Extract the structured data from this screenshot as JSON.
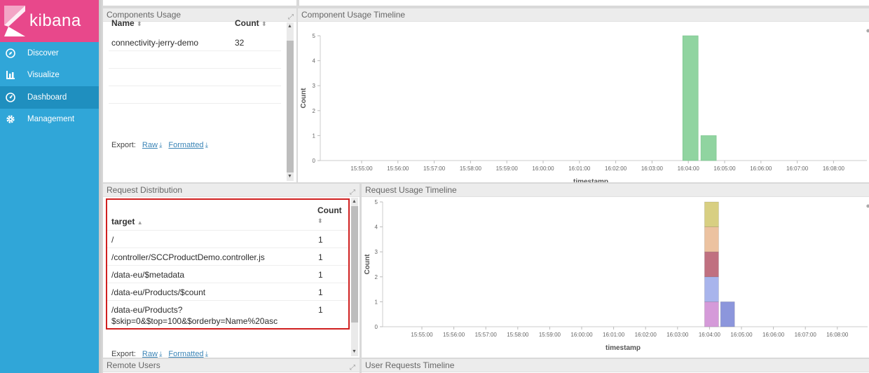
{
  "sidebar": {
    "logo_text": "kibana",
    "items": [
      {
        "label": "Discover",
        "icon": "compass-icon"
      },
      {
        "label": "Visualize",
        "icon": "bar-chart-icon"
      },
      {
        "label": "Dashboard",
        "icon": "dashboard-icon",
        "active": true
      },
      {
        "label": "Management",
        "icon": "gear-icon"
      }
    ]
  },
  "colors": {
    "sidebar": "#30a6d8",
    "logo_bg": "#e8488b",
    "link": "#3a84b6",
    "highlight_border": "#d02020"
  },
  "components_usage": {
    "title": "Components Usage",
    "col_name": "Name",
    "col_count": "Count",
    "rows": [
      {
        "name": "connectivity-jerry-demo",
        "count": "32"
      }
    ],
    "export_label": "Export:",
    "raw_label": "Raw",
    "formatted_label": "Formatted"
  },
  "component_timeline": {
    "title": "Component Usage Timeline"
  },
  "request_distribution": {
    "title": "Request Distribution",
    "col_target": "target",
    "col_count": "Count",
    "rows": [
      {
        "target": "/",
        "count": "1"
      },
      {
        "target": "/controller/SCCProductDemo.controller.js",
        "count": "1"
      },
      {
        "target": "/data-eu/$metadata",
        "count": "1"
      },
      {
        "target": "/data-eu/Products/$count",
        "count": "1"
      },
      {
        "target": "/data-eu/Products?",
        "target2": "$skip=0&$top=100&$orderby=Name%20asc",
        "count": "1"
      }
    ],
    "export_label": "Export:",
    "raw_label": "Raw",
    "formatted_label": "Formatted"
  },
  "request_timeline": {
    "title": "Request Usage Timeline"
  },
  "remote_users": {
    "title": "Remote Users"
  },
  "user_requests_timeline": {
    "title": "User Requests Timeline"
  },
  "chart_data": [
    {
      "type": "bar",
      "title": "Component Usage Timeline",
      "xlabel": "timestamp",
      "ylabel": "Count",
      "x_ticks": [
        "15:55:00",
        "15:56:00",
        "15:57:00",
        "15:58:00",
        "15:59:00",
        "16:00:00",
        "16:01:00",
        "16:02:00",
        "16:03:00",
        "16:04:00",
        "16:05:00",
        "16:06:00",
        "16:07:00",
        "16:08:00"
      ],
      "y_ticks": [
        0,
        1,
        2,
        3,
        4,
        5
      ],
      "ylim": [
        0,
        5
      ],
      "series": [
        {
          "color": "#90d4a0",
          "points": [
            {
              "x": "16:04:00",
              "y": 5
            },
            {
              "x": "16:04:30",
              "y": 1
            }
          ]
        }
      ]
    },
    {
      "type": "bar",
      "title": "Request Usage Timeline",
      "stacked": true,
      "xlabel": "timestamp",
      "ylabel": "Count",
      "x_ticks": [
        "15:55:00",
        "15:56:00",
        "15:57:00",
        "15:58:00",
        "15:59:00",
        "16:00:00",
        "16:01:00",
        "16:02:00",
        "16:03:00",
        "16:04:00",
        "16:05:00",
        "16:06:00",
        "16:07:00",
        "16:08:00"
      ],
      "y_ticks": [
        0,
        1,
        2,
        3,
        4,
        5
      ],
      "ylim": [
        0,
        5
      ],
      "stacks": [
        {
          "x": "16:04:00",
          "segments": [
            {
              "y": 1,
              "color": "#d59ad9"
            },
            {
              "y": 1,
              "color": "#a8b4ec"
            },
            {
              "y": 1,
              "color": "#c07080"
            },
            {
              "y": 1,
              "color": "#ecc2a0"
            },
            {
              "y": 1,
              "color": "#d8cf82"
            }
          ]
        },
        {
          "x": "16:04:30",
          "segments": [
            {
              "y": 1,
              "color": "#8c96dc"
            }
          ]
        }
      ]
    }
  ]
}
